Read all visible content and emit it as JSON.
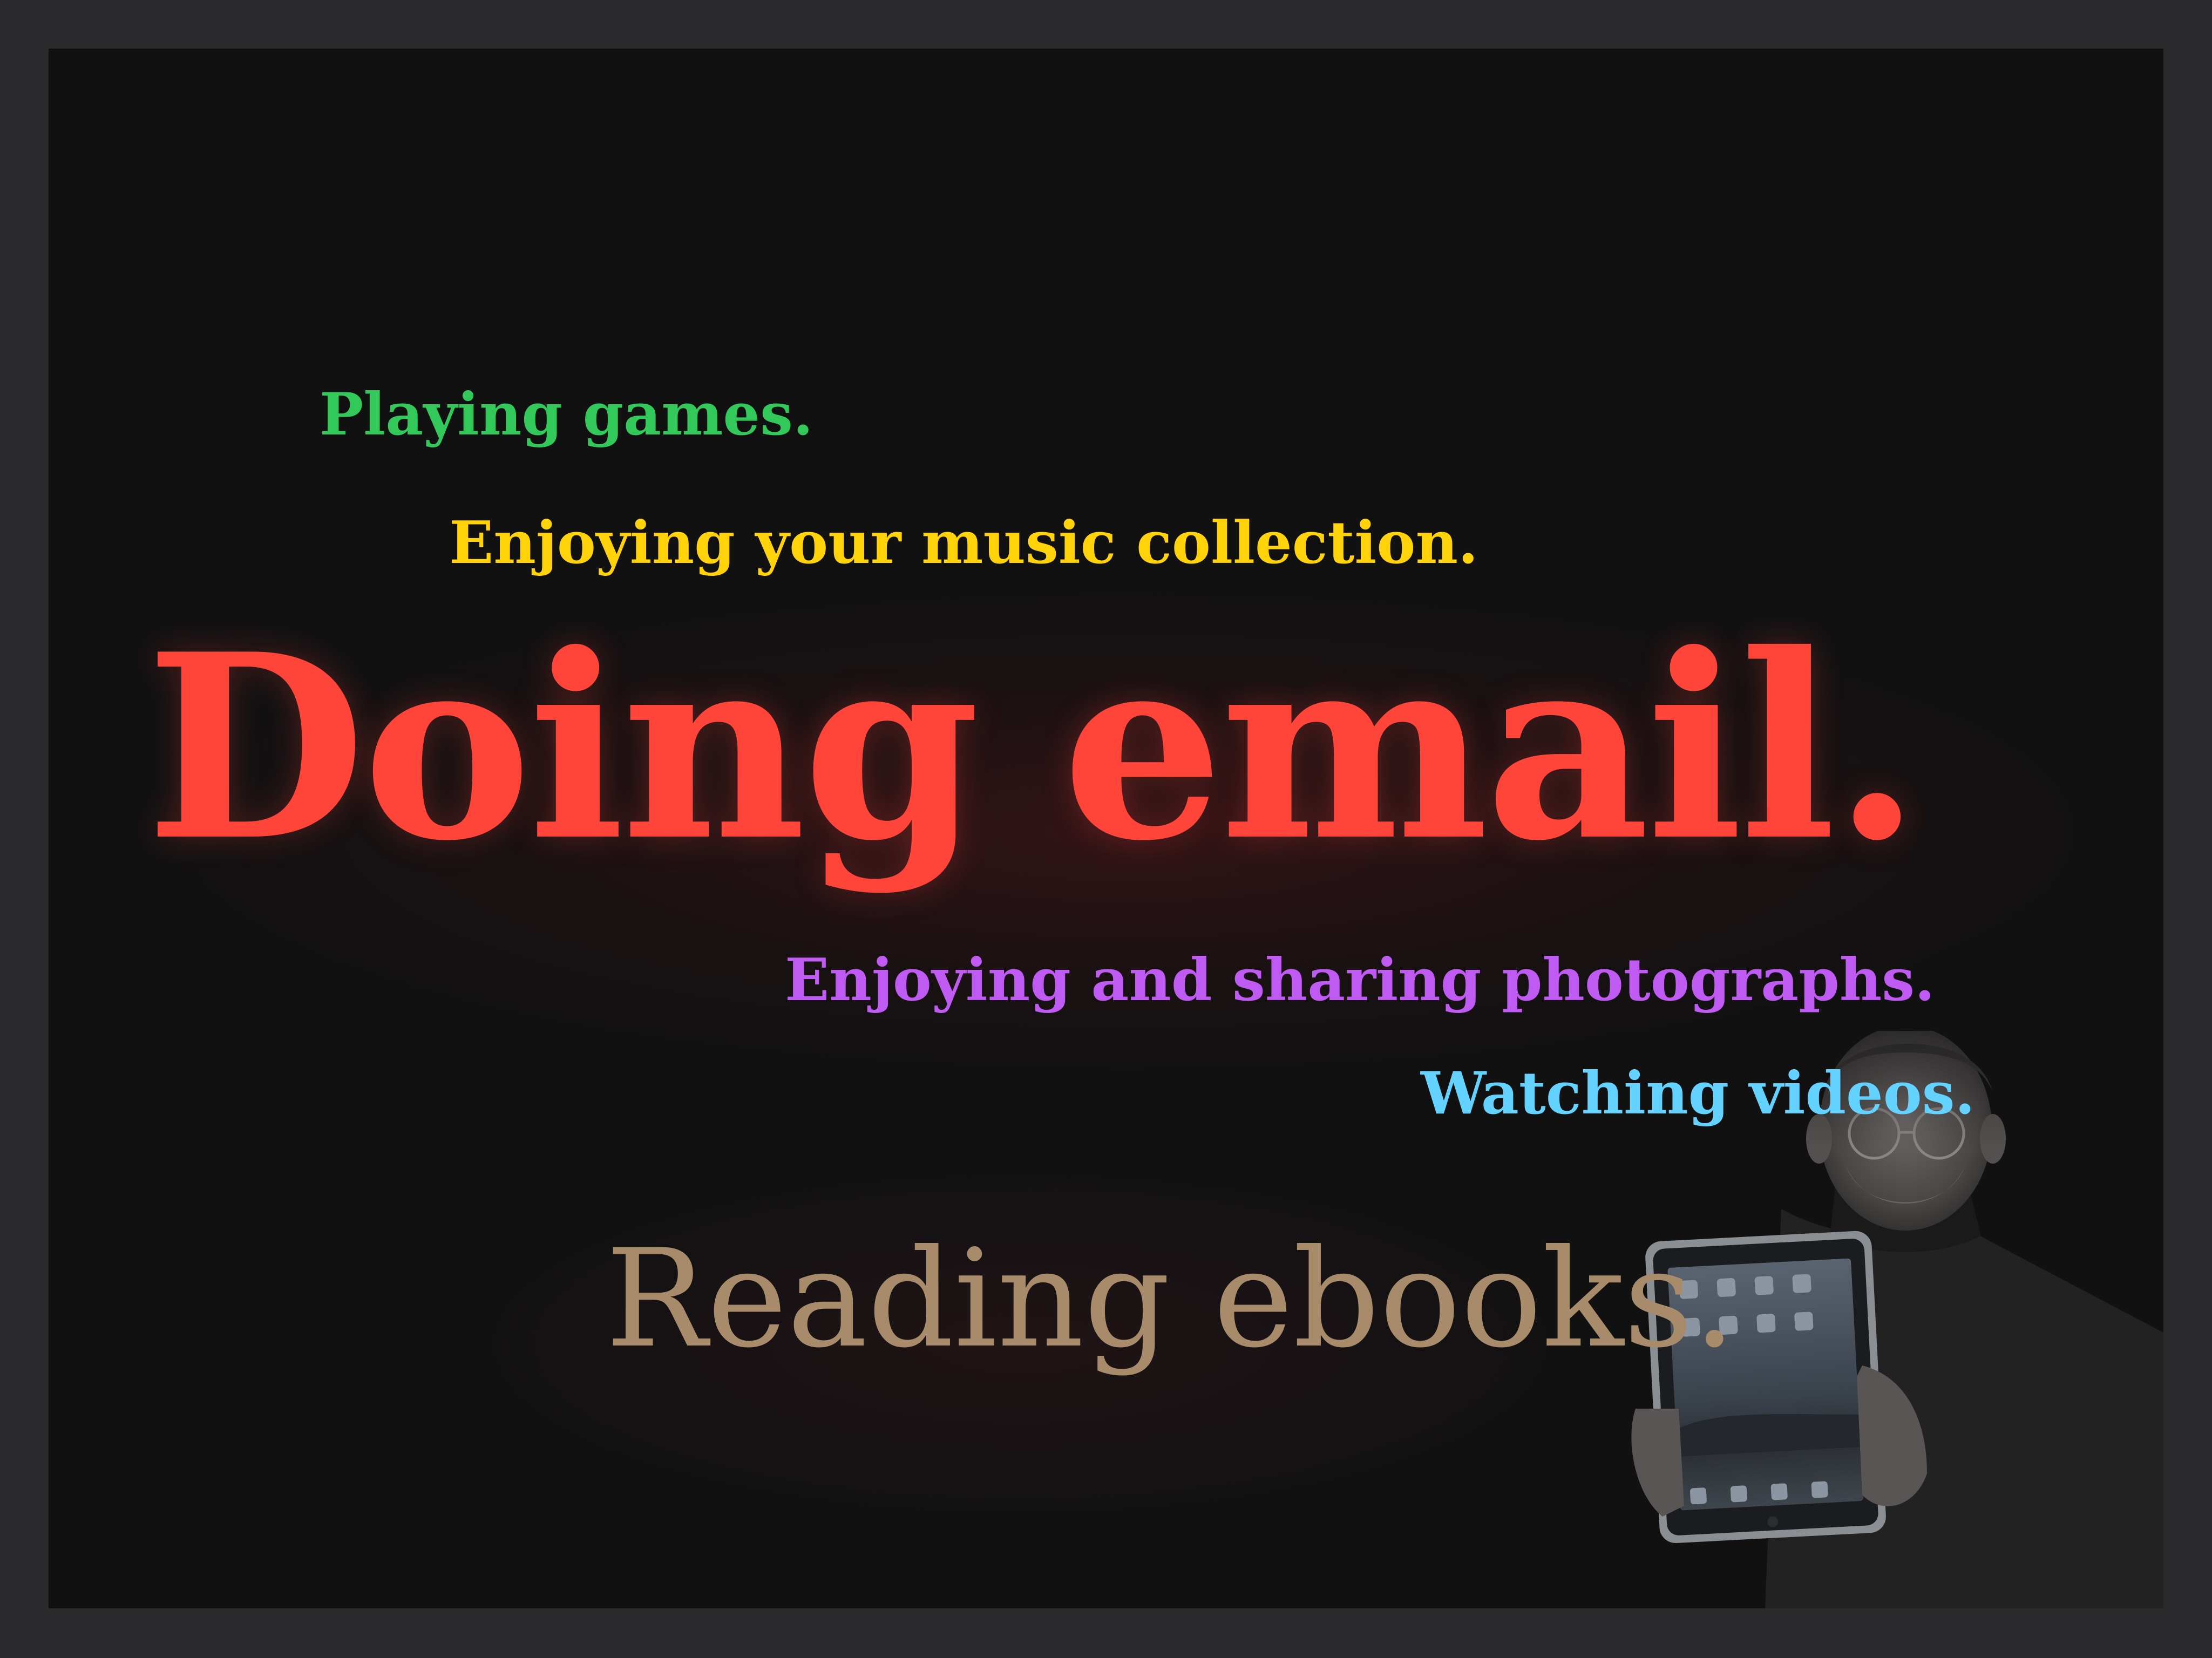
{
  "slide": {
    "lines": {
      "games": "Playing games.",
      "music": "Enjoying your music collection.",
      "email": "Doing email.",
      "photos": "Enjoying and sharing photographs.",
      "videos": "Watching videos.",
      "ebooks": "Reading ebooks."
    },
    "colors": {
      "background": "#111112",
      "frame": "#2b2b2d",
      "games": "#33c95a",
      "music": "#ffd20a",
      "email": "#ff453a",
      "photos": "#bf5af2",
      "videos": "#64d2ff",
      "ebooks": "#a78b6a"
    },
    "image": {
      "subject": "presenter-holding-tablet"
    }
  }
}
